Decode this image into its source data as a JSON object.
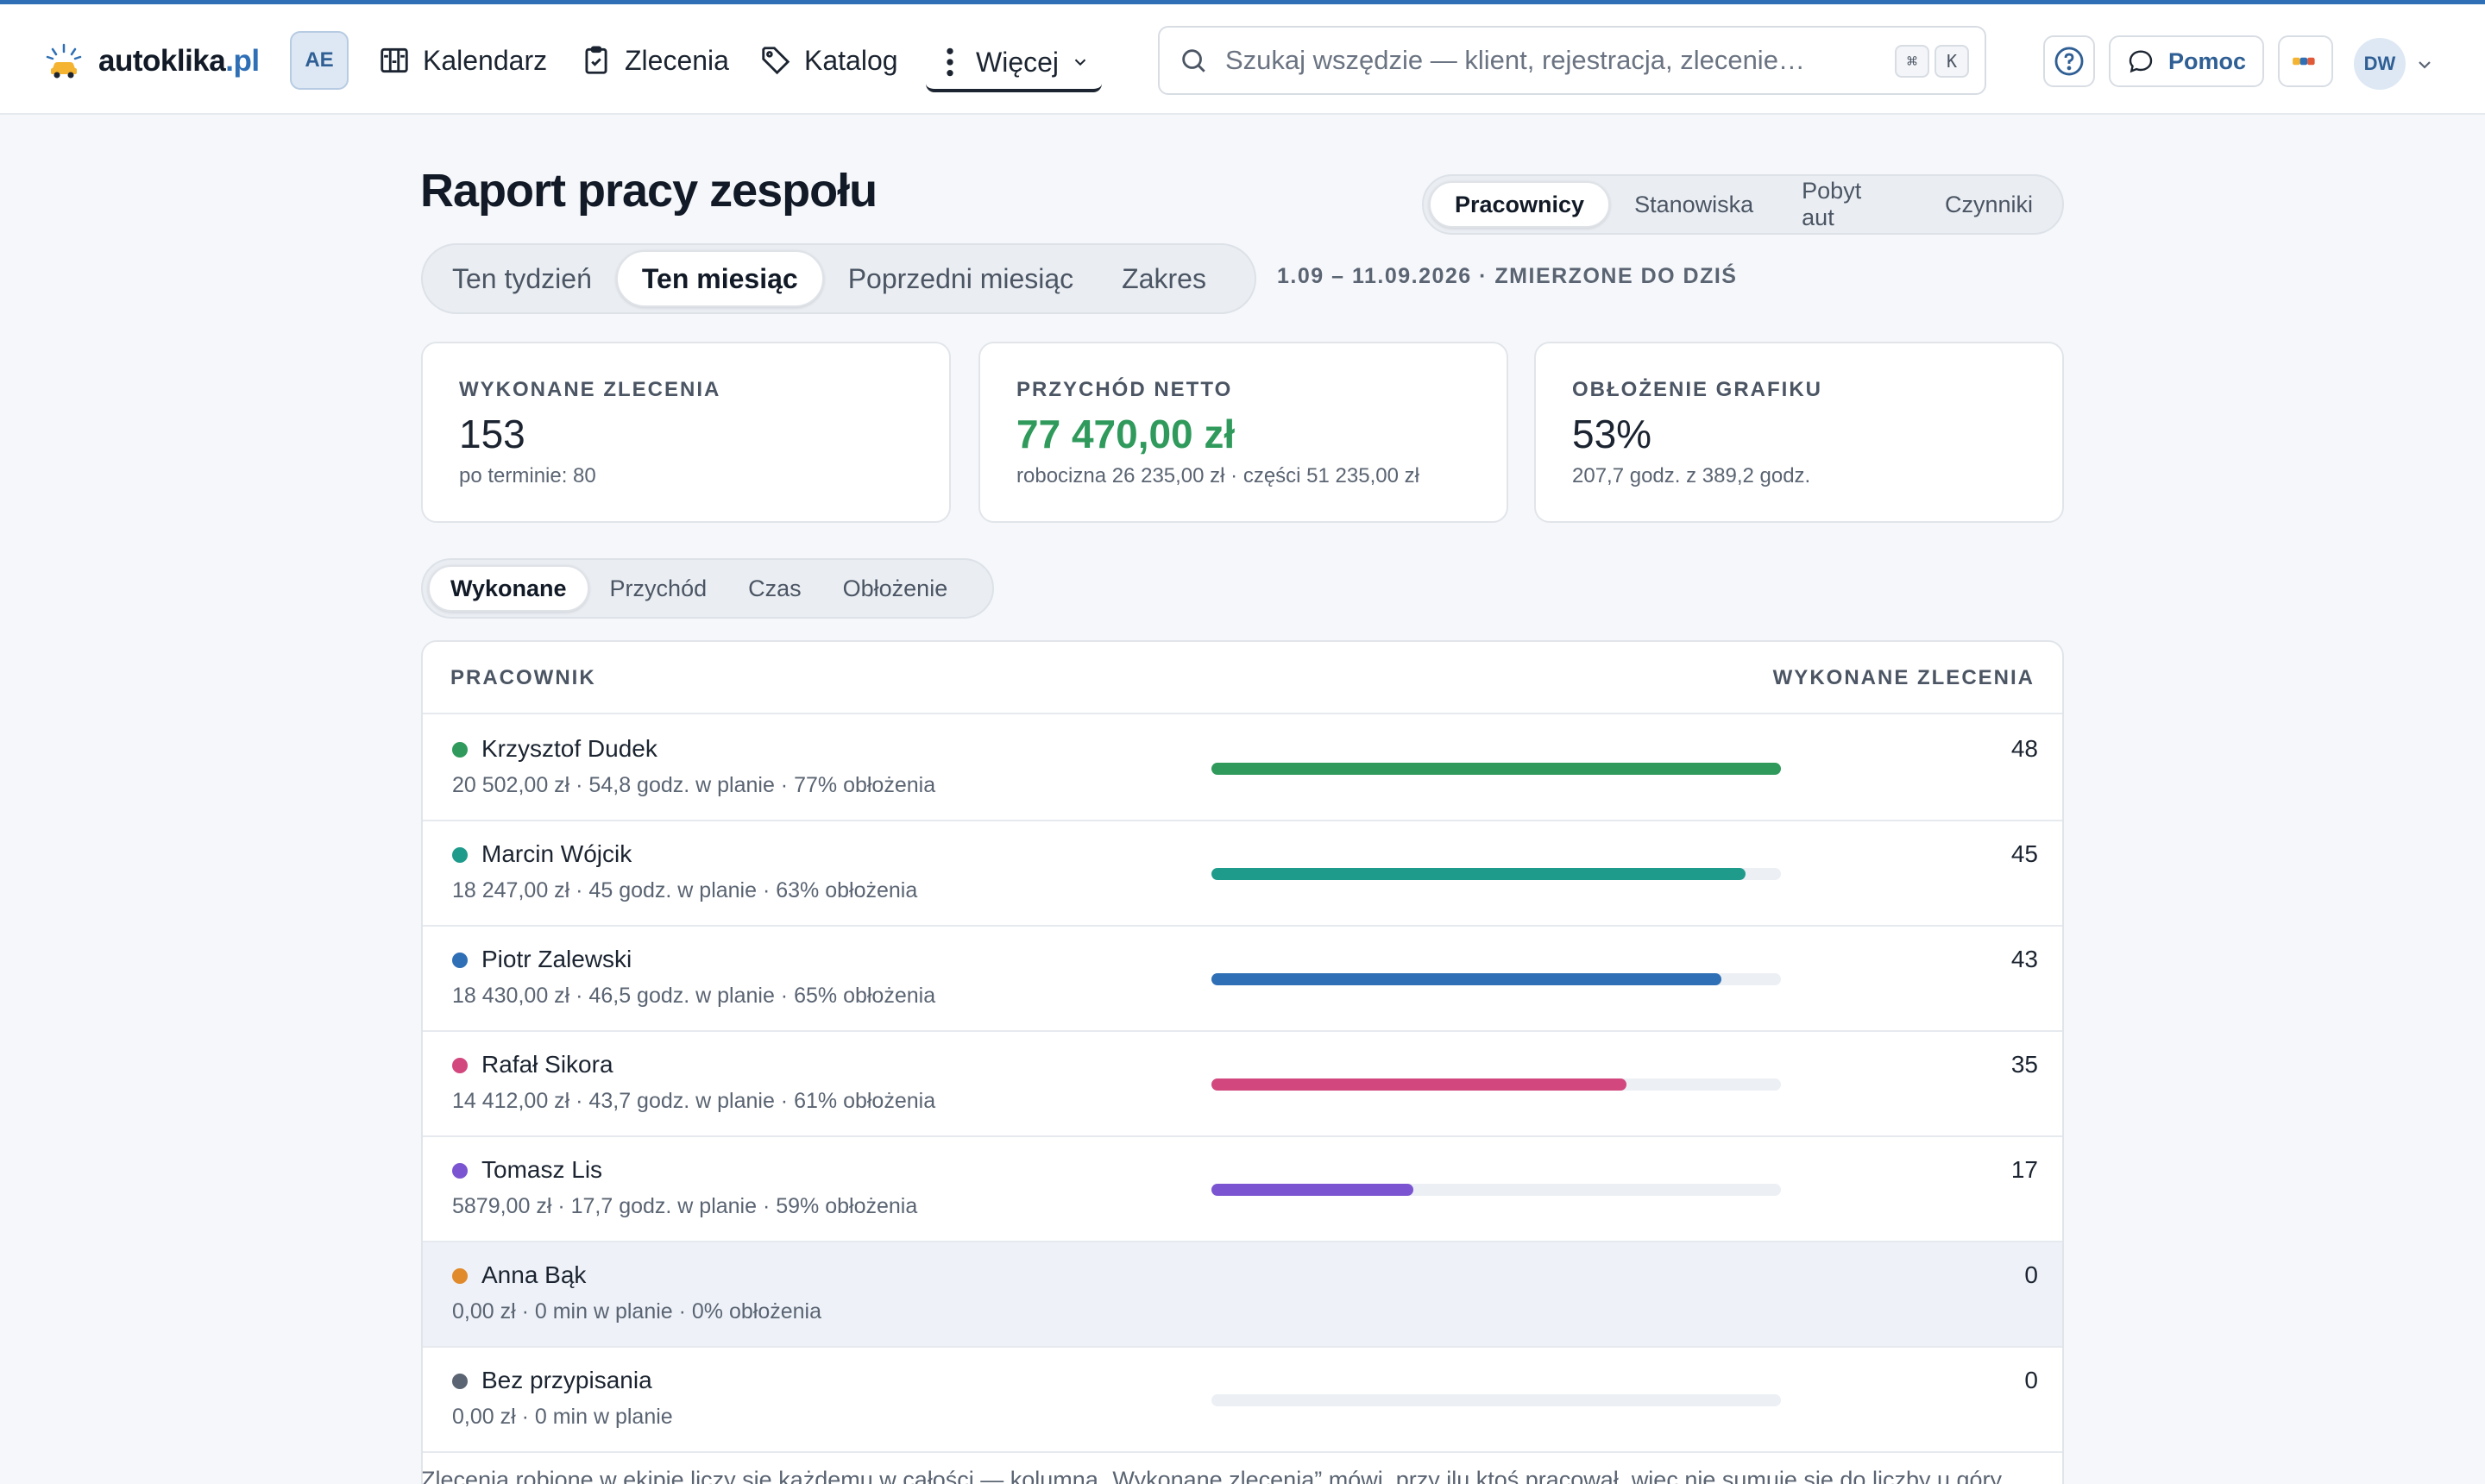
{
  "brand": {
    "name_main": "autoklika",
    "name_tld": ".pl",
    "workspace_badge": "AE"
  },
  "nav": {
    "calendar": "Kalendarz",
    "orders": "Zlecenia",
    "catalog": "Katalog",
    "more": "Więcej"
  },
  "search": {
    "placeholder": "Szukaj wszędzie — klient, rejestracja, zlecenie…",
    "kbd1": "⌘",
    "kbd2": "K"
  },
  "header_actions": {
    "help_label": "Pomoc",
    "avatar_initials": "DW"
  },
  "page": {
    "title": "Raport pracy zespołu",
    "view_tabs": [
      "Pracownicy",
      "Stanowiska",
      "Pobyt aut",
      "Czynniki"
    ],
    "view_active": "Pracownicy",
    "period_tabs": [
      "Ten tydzień",
      "Ten miesiąc",
      "Poprzedni miesiąc",
      "Zakres"
    ],
    "period_active": "Ten miesiąc",
    "period_label": "1.09 – 11.09.2026 · ZMIERZONE DO DZIŚ"
  },
  "stats": [
    {
      "label": "WYKONANE ZLECENIA",
      "value": "153",
      "sub": "po terminie: 80"
    },
    {
      "label": "PRZYCHÓD NETTO",
      "value": "77 470,00 zł",
      "sub": "robocizna 26 235,00 zł · części 51 235,00 zł"
    },
    {
      "label": "OBŁOŻENIE GRAFIKU",
      "value": "53%",
      "sub": "207,7 godz. z 389,2 godz."
    }
  ],
  "metric_tabs": [
    "Wykonane",
    "Przychód",
    "Czas",
    "Obłożenie"
  ],
  "metric_active": "Wykonane",
  "table": {
    "col_left": "PRACOWNIK",
    "col_right": "WYKONANE ZLECENIA",
    "rows": [
      {
        "name": "Krzysztof Dudek",
        "meta": "20 502,00 zł · 54,8 godz. w planie · 77% obłożenia",
        "count": "48",
        "fraction": 1.0,
        "color": "#2f9a5b"
      },
      {
        "name": "Marcin Wójcik",
        "meta": "18 247,00 zł · 45 godz. w planie · 63% obłożenia",
        "count": "45",
        "fraction": 0.9375,
        "color": "#1f9b8b"
      },
      {
        "name": "Piotr Zalewski",
        "meta": "18 430,00 zł · 46,5 godz. w planie · 65% obłożenia",
        "count": "43",
        "fraction": 0.8958,
        "color": "#2f6fb5"
      },
      {
        "name": "Rafał Sikora",
        "meta": "14 412,00 zł · 43,7 godz. w planie · 61% obłożenia",
        "count": "35",
        "fraction": 0.7292,
        "color": "#d2477e"
      },
      {
        "name": "Tomasz Lis",
        "meta": "5879,00 zł · 17,7 godz. w planie · 59% obłożenia",
        "count": "17",
        "fraction": 0.3542,
        "color": "#7b55d1"
      },
      {
        "name": "Anna Bąk",
        "meta": "0,00 zł · 0 min w planie · 0% obłożenia",
        "count": "0",
        "fraction": 0,
        "color": "#e08a2b"
      },
      {
        "name": "Bez przypisania",
        "meta": "0,00 zł · 0 min w planie",
        "count": "0",
        "fraction": 0,
        "color": "#5b6472"
      }
    ]
  },
  "footnote": "Zlecenia robione w ekipie liczy się każdemu w całości — kolumna „Wykonane zlecenia” mówi, przy ilu ktoś pracował, więc nie sumuje się do liczby u góry."
}
